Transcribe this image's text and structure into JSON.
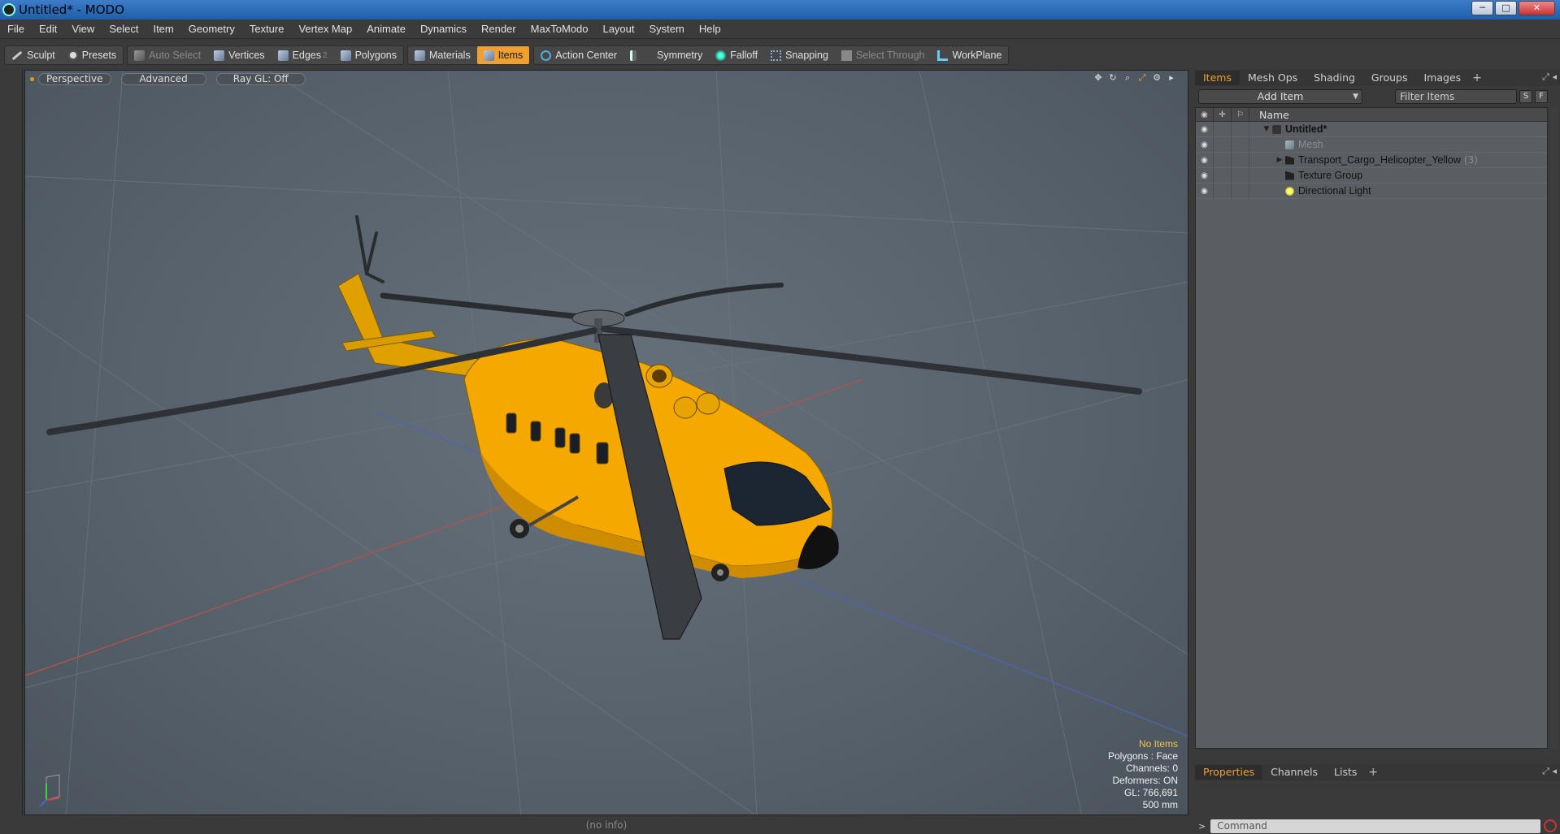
{
  "window": {
    "title": "Untitled* - MODO",
    "min_label": "─",
    "max_label": "□",
    "close_label": "✕"
  },
  "menu": [
    "File",
    "Edit",
    "View",
    "Select",
    "Item",
    "Geometry",
    "Texture",
    "Vertex Map",
    "Animate",
    "Dynamics",
    "Render",
    "MaxToModo",
    "Layout",
    "System",
    "Help"
  ],
  "toolbar": {
    "sculpt": "Sculpt",
    "presets": "Presets",
    "auto_select": "Auto Select",
    "vertices": "Vertices",
    "edges": "Edges",
    "edges_count": "2",
    "polygons": "Polygons",
    "materials": "Materials",
    "items": "Items",
    "action_center": "Action Center",
    "symmetry": "Symmetry",
    "falloff": "Falloff",
    "snapping": "Snapping",
    "select_through": "Select Through",
    "workplane": "WorkPlane"
  },
  "viewport": {
    "view_mode": "Perspective",
    "shading": "Advanced",
    "raygl": "Ray GL: Off",
    "info": {
      "no_items": "No Items",
      "polygons": "Polygons : Face",
      "channels": "Channels: 0",
      "deformers": "Deformers: ON",
      "gl": "GL: 766,691",
      "scale": "500 mm"
    }
  },
  "status": "(no info)",
  "panel": {
    "tabs": [
      "Items",
      "Mesh Ops",
      "Shading",
      "Groups",
      "Images"
    ],
    "add_item": "Add Item",
    "filter_placeholder": "Filter Items",
    "s_btn": "S",
    "f_btn": "F",
    "name_header": "Name",
    "tree": [
      {
        "label": "Untitled*",
        "bold": true,
        "dim": false,
        "count": "",
        "indent": 0,
        "expander": "▼",
        "icon": "ico-scene"
      },
      {
        "label": "Mesh",
        "bold": false,
        "dim": true,
        "count": "",
        "indent": 1,
        "expander": "",
        "icon": "ico-mesh"
      },
      {
        "label": "Transport_Cargo_Helicopter_Yellow",
        "bold": false,
        "dim": false,
        "count": "(3)",
        "indent": 1,
        "expander": "▶",
        "icon": "ico-group"
      },
      {
        "label": "Texture Group",
        "bold": false,
        "dim": false,
        "count": "",
        "indent": 1,
        "expander": "",
        "icon": "ico-group"
      },
      {
        "label": "Directional Light",
        "bold": false,
        "dim": false,
        "count": "",
        "indent": 1,
        "expander": "",
        "icon": "ico-light"
      }
    ],
    "props_tabs": [
      "Properties",
      "Channels",
      "Lists"
    ],
    "command_placeholder": "Command"
  },
  "colors": {
    "accent": "#f0a030",
    "helicopter": "#f5a800",
    "viewport_bg": "#5c6670"
  }
}
